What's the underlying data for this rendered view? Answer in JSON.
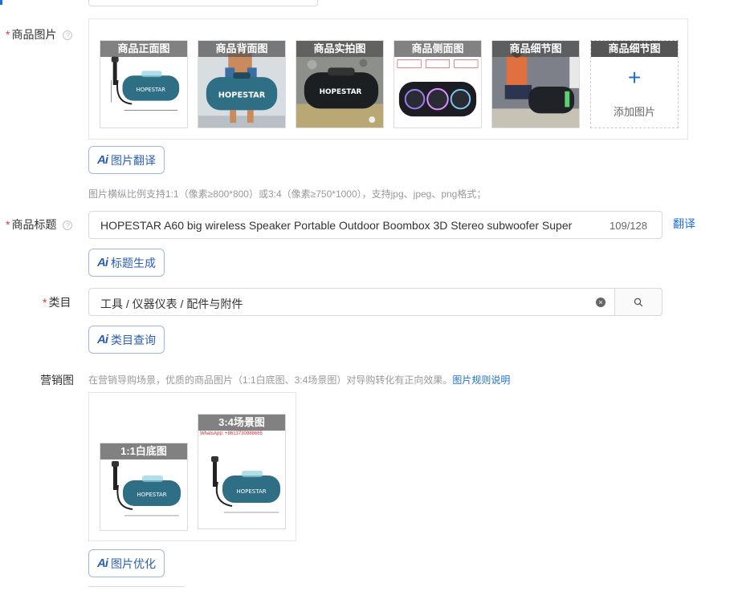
{
  "fields": {
    "images": {
      "label": "商品图片",
      "required_mark": "*",
      "help_glyph": "?",
      "thumbnails": [
        {
          "caption": "商品正面图",
          "icon": "speaker-front-image"
        },
        {
          "caption": "商品背面图",
          "icon": "speaker-back-image"
        },
        {
          "caption": "商品实拍图",
          "icon": "speaker-real-photo-image"
        },
        {
          "caption": "商品侧面图",
          "icon": "speaker-side-image"
        },
        {
          "caption": "商品细节图",
          "icon": "speaker-detail-image"
        }
      ],
      "add_slot": {
        "caption": "商品细节图",
        "plus": "+",
        "text": "添加图片"
      },
      "ai_button": "图片翻译",
      "hint": "图片横纵比例支持1:1（像素≥800*800）或3:4（像素≥750*1000），支持jpg、jpeg、png格式；"
    },
    "title": {
      "label": "商品标题",
      "required_mark": "*",
      "help_glyph": "?",
      "value": "HOPESTAR A60 big wireless Speaker Portable Outdoor Boombox 3D Stereo subwoofer Super",
      "counter": "109/128",
      "translate": "翻译",
      "ai_button": "标题生成"
    },
    "category": {
      "label": "类目",
      "required_mark": "*",
      "value": "工具 / 仪器仪表 / 配件与附件",
      "clear_glyph": "×",
      "ai_button": "类目查询"
    },
    "marketing": {
      "label": "营销图",
      "hint": "在营销导购场景，优质的商品图片（1:1白底图、3:4场景图）对导购转化有正向效果。",
      "hint_link": "图片规则说明",
      "thumbnails": [
        {
          "caption": "1:1白底图",
          "icon": "speaker-white-bg-image"
        },
        {
          "caption": "3:4场景图",
          "icon": "speaker-scene-image",
          "watermark": "WhatsApp: +8613730988665"
        }
      ],
      "ai_button": "图片优化"
    },
    "ai_mark": "Ai"
  },
  "colors": {
    "accent": "#1e6fd9",
    "ai_text": "#2b5fb3",
    "required": "#e53935",
    "hint": "#999999",
    "speaker_body": "#2f6f86"
  }
}
